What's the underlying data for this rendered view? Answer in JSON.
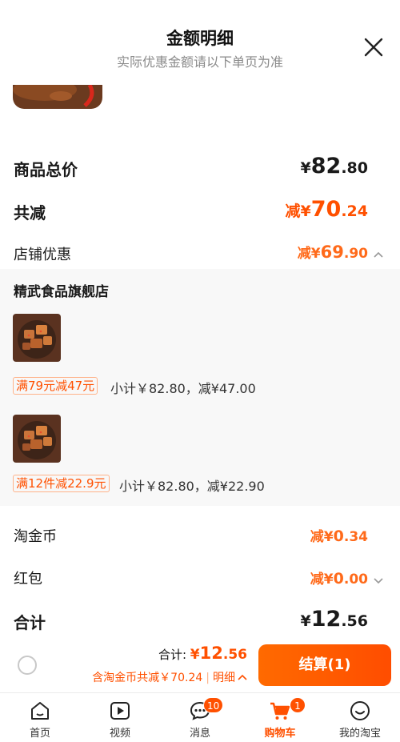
{
  "header": {
    "title": "金额明细",
    "subtitle": "实际优惠金额请以下单页为准"
  },
  "summary": {
    "goods_total_label": "商品总价",
    "goods_total": {
      "cur": "¥",
      "int": "82",
      "dec": ".80"
    },
    "total_discount_label": "共减",
    "total_discount": {
      "cur": "减¥",
      "int": "70",
      "dec": ".24"
    },
    "shop_discount_label": "店铺优惠",
    "shop_discount": {
      "cur": "减¥",
      "int": "69",
      "dec": ".90"
    }
  },
  "shop": {
    "name": "精武食品旗舰店",
    "promotions": [
      {
        "tag": "满79元减47元",
        "detail": "小计￥82.80，减¥47.00"
      },
      {
        "tag": "满12件减22.9元",
        "detail": "小计￥82.80，减¥22.90"
      }
    ]
  },
  "extras": {
    "coin_label": "淘金币",
    "coin_value": {
      "cur": "减¥",
      "int": "0",
      "dec": ".34"
    },
    "redpacket_label": "红包",
    "redpacket_value": {
      "cur": "减¥",
      "int": "0",
      "dec": ".00"
    },
    "grand_total_label": "合计",
    "grand_total": {
      "cur": "¥",
      "int": "12",
      "dec": ".56"
    }
  },
  "checkout": {
    "total_prefix": "合计:",
    "total": {
      "cur": "¥",
      "int": "12",
      "dec": ".56"
    },
    "coin_note": "含淘金币共减￥70.24",
    "detail_link": "明细",
    "pay_label": "结算(1)"
  },
  "tabbar": [
    {
      "label": "首页",
      "icon": "home-icon"
    },
    {
      "label": "视频",
      "icon": "video-icon"
    },
    {
      "label": "消息",
      "icon": "message-icon",
      "badge": "10"
    },
    {
      "label": "购物车",
      "icon": "cart-icon",
      "badge": "1",
      "active": true
    },
    {
      "label": "我的淘宝",
      "icon": "profile-icon"
    }
  ],
  "colors": {
    "accent": "#ff5000"
  }
}
